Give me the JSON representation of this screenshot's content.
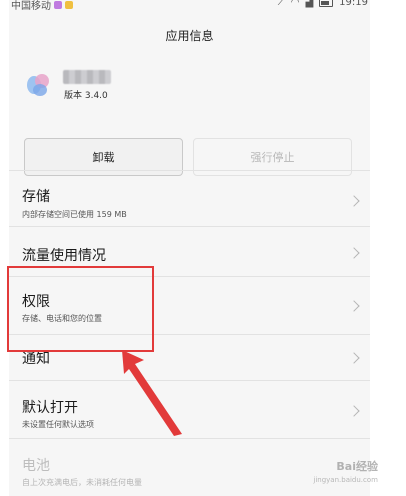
{
  "status_bar": {
    "carrier": "中国移动",
    "time": "19:19"
  },
  "header": {
    "title": "应用信息"
  },
  "app": {
    "version": "版本 3.4.0"
  },
  "buttons": {
    "uninstall": "卸载",
    "force_stop": "强行停止"
  },
  "settings": [
    {
      "title": "存储",
      "subtitle": "内部存储空间已使用 159 MB"
    },
    {
      "title": "流量使用情况",
      "subtitle": ""
    },
    {
      "title": "权限",
      "subtitle": "存储、电话和您的位置"
    },
    {
      "title": "通知",
      "subtitle": ""
    },
    {
      "title": "默认打开",
      "subtitle": "未设置任何默认选项"
    },
    {
      "title": "电池",
      "subtitle": "自上次充满电后，未消耗任何电量"
    }
  ],
  "watermark": {
    "text": "Bai经验",
    "sub": "jingyan.baidu.com"
  },
  "colors": {
    "annotation": "#e23a3a",
    "page_bg": "#f6f6f6",
    "disabled_text": "#bdbdbd"
  }
}
